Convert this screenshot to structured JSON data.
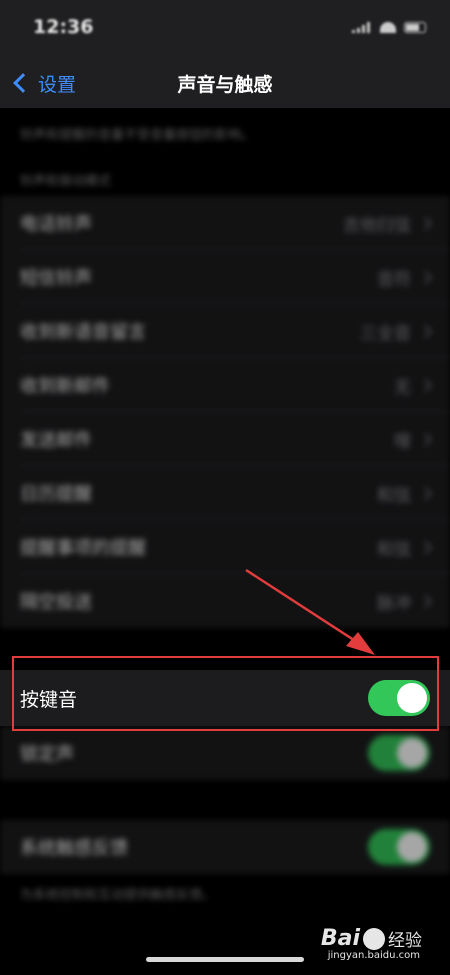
{
  "status": {
    "time": "12:36"
  },
  "nav": {
    "back_label": "设置",
    "title": "声音与触感"
  },
  "top_note": "铃声和提醒的音量不受音量按钮的影响。",
  "section_header": "铃声和振动模式",
  "sound_rows": [
    {
      "label": "电话铃声",
      "value": "吉他扫弦"
    },
    {
      "label": "短信铃声",
      "value": "音符"
    },
    {
      "label": "收到新语音留言",
      "value": "三全音"
    },
    {
      "label": "收到新邮件",
      "value": "无"
    },
    {
      "label": "发送邮件",
      "value": "嗖"
    },
    {
      "label": "日历提醒",
      "value": "和弦"
    },
    {
      "label": "提醒事项的提醒",
      "value": "和弦"
    },
    {
      "label": "隔空投送",
      "value": "脉冲"
    }
  ],
  "keyboard_clicks": {
    "label": "按键音",
    "on": true
  },
  "lock_sound": {
    "label": "锁定声",
    "on": true
  },
  "system_haptics": {
    "label": "系统触感反馈",
    "on": true
  },
  "bottom_note": "为系统控制和互动提供触感反馈。",
  "watermark": {
    "brand": "Bai",
    "brand2": "经验",
    "url": "jingyan.baidu.com"
  },
  "colors": {
    "accent": "#3f8cff",
    "toggle_on": "#33c759",
    "highlight": "#e23c3c"
  }
}
